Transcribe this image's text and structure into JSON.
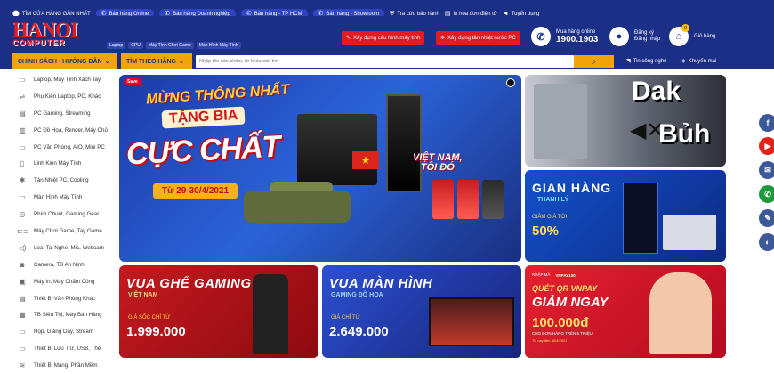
{
  "topbar": {
    "store_finder": "TÌM CỬA HÀNG GẦN NHẤT",
    "pills": [
      "Bán hàng Online",
      "Bán hàng Doanh nghiệp",
      "Bán hàng - TP HCM",
      "Bán hàng - Showroom"
    ],
    "warranty": "Tra cứu bảo hành",
    "invoice": "In hóa đơn điện tử",
    "jobs": "Tuyển dụng"
  },
  "header": {
    "logo_top": "HANOI",
    "logo_bottom": "COMPUTER",
    "quick_links": [
      "Laptop",
      "CPU",
      "Máy Tính Chơi Game",
      "Màn Hình Máy Tính"
    ],
    "build_pc": "Xây dựng cấu hình máy tính",
    "build_cooling": "Xây dựng tản nhiệt nước PC",
    "hotline_label": "Mua hàng online",
    "hotline_number": "1900.1903",
    "register": "Đăng ký",
    "login": "Đăng nhập",
    "cart_label": "Giỏ hàng",
    "cart_count": "0"
  },
  "nav": {
    "policy": "CHÍNH SÁCH - HƯỚNG DẪN",
    "by_brand": "TÌM THEO HÃNG",
    "search_placeholder": "Nhập tên sản phẩm, từ khóa cần tìm",
    "tech_news": "Tin công nghệ",
    "promo": "Khuyến mại"
  },
  "sidebar": {
    "items": [
      {
        "label": "Laptop, Máy Tính Xách Tay",
        "icon": "laptop-icon",
        "glyph": "▭"
      },
      {
        "label": "Phụ Kiện Laptop, PC, Khác",
        "icon": "usb-icon",
        "glyph": "⇌"
      },
      {
        "label": "PC Gaming, Streaming",
        "icon": "desktop-icon",
        "glyph": "▤"
      },
      {
        "label": "PC Đồ Họa, Render, Máy Chủ",
        "icon": "server-icon",
        "glyph": "▥"
      },
      {
        "label": "PC Văn Phòng, AIO, Mini PC",
        "icon": "monitor-icon",
        "glyph": "▭"
      },
      {
        "label": "Linh Kiện Máy Tính",
        "icon": "component-icon",
        "glyph": "▯"
      },
      {
        "label": "Tản Nhiệt PC, Cooling",
        "icon": "fan-icon",
        "glyph": "✱"
      },
      {
        "label": "Màn Hình Máy Tính",
        "icon": "monitor-icon",
        "glyph": "▭"
      },
      {
        "label": "Phím Chuột, Gaming Gear",
        "icon": "mouse-icon",
        "glyph": "◎"
      },
      {
        "label": "Máy Chơi Game, Tay Game",
        "icon": "gamepad-icon",
        "glyph": "⊏⊐"
      },
      {
        "label": "Loa, Tai Nghe, Mic, Webcam",
        "icon": "speaker-icon",
        "glyph": "◁)"
      },
      {
        "label": "Camera, TB An Ninh",
        "icon": "camera-icon",
        "glyph": "◙"
      },
      {
        "label": "Máy In, Máy Chấm Công",
        "icon": "printer-icon",
        "glyph": "▣"
      },
      {
        "label": "Thiết Bị Văn Phòng Khác",
        "icon": "office-icon",
        "glyph": "▤"
      },
      {
        "label": "TB Siêu Thị, Máy Bán Hàng",
        "icon": "pos-icon",
        "glyph": "▦"
      },
      {
        "label": "Họp, Giảng Dạy, Stream",
        "icon": "meeting-icon",
        "glyph": "▭"
      },
      {
        "label": "Thiết Bị Lưu Trữ, USB, Thẻ",
        "icon": "storage-icon",
        "glyph": "▭"
      },
      {
        "label": "Thiết Bị Mạng, Phần Mềm",
        "icon": "wifi-icon",
        "glyph": "≋"
      }
    ]
  },
  "main_banner": {
    "save": "Save",
    "line1": "MỪNG THỐNG NHẤT",
    "line2": "TẶNG BIA",
    "line3": "CỰC CHẤT",
    "dates": "Từ 29-30/4/2021",
    "slogan_1": "VIỆT NAM,",
    "slogan_2": "TÔI ĐÓ"
  },
  "right_banners": {
    "dak_1": "Dak",
    "dak_2": "Bủh",
    "sale_title": "GIAN HÀNG",
    "sale_sub": "THANH LÝ",
    "sale_discount_label": "GIẢM GIÁ TỚI",
    "sale_discount": "50%"
  },
  "bottom_banners": {
    "chair_title": "VUA GHẾ GAMING",
    "chair_sub": "VIỆT NAM",
    "chair_price_label": "GIÁ SỐC CHỈ TỪ",
    "chair_price": "1.999.000",
    "monitor_title": "VUA MÀN HÌNH",
    "monitor_sub": "GAMING ĐỒ HỌA",
    "monitor_price_label": "GIÁ CHỈ TỪ",
    "monitor_price": "2.649.000",
    "vnpay_tag1": "NHẬP MÃ",
    "vnpay_tag2": "VNPAY100",
    "vnpay_title": "QUÉT QR VNPAY",
    "vnpay_discount": "GIẢM NGAY",
    "vnpay_amount": "100.000đ",
    "vnpay_cond": "CHO ĐƠN HÀNG TRÊN 5 TRIỆU",
    "vnpay_date": "Từ nay đến 30/4/2021"
  },
  "social": [
    "f",
    "▶",
    "✉",
    "✆",
    "✎",
    "◐"
  ]
}
